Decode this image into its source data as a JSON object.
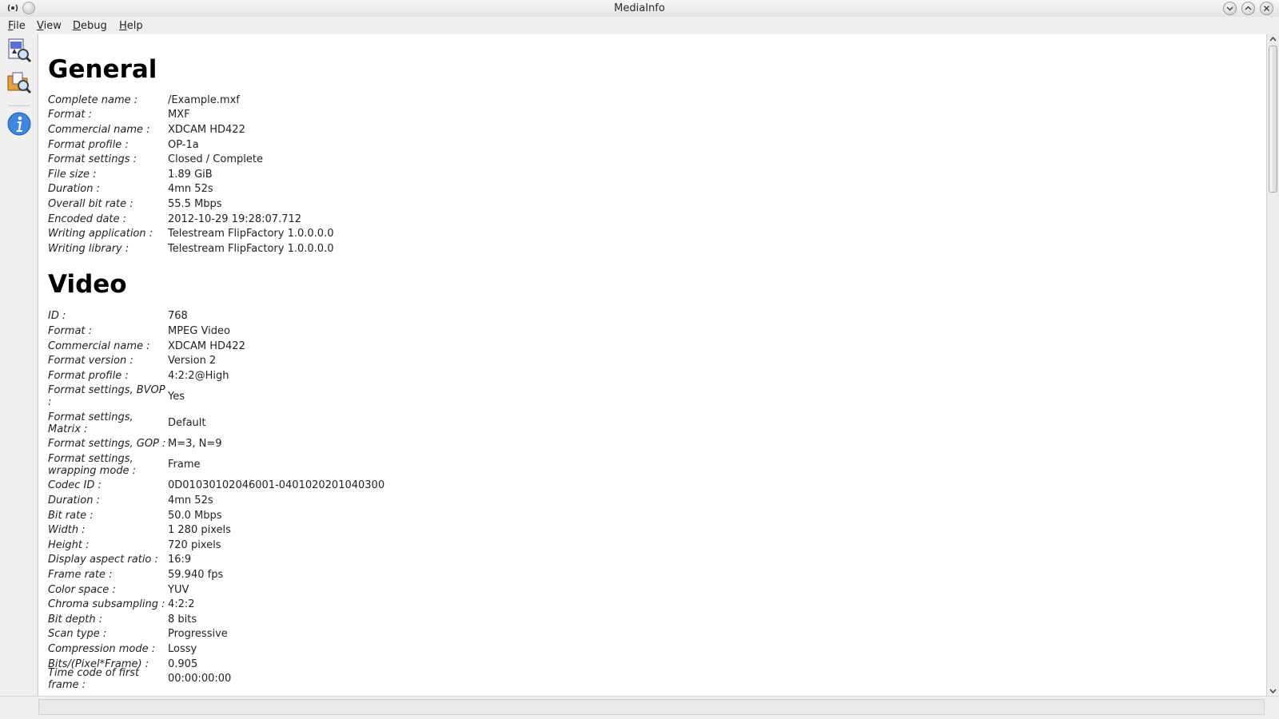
{
  "window": {
    "title": "MediaInfo"
  },
  "menu": [
    {
      "first": "F",
      "rest": "ile"
    },
    {
      "first": "V",
      "rest": "iew"
    },
    {
      "first": "D",
      "rest": "ebug"
    },
    {
      "first": "H",
      "rest": "elp"
    }
  ],
  "toolbar": {
    "open_file_icon": "open-file-icon",
    "open_folder_icon": "open-folder-icon",
    "about_icon": "info-icon"
  },
  "sections": [
    {
      "title": "General",
      "rows": [
        {
          "k": "Complete name :",
          "v": "/Example.mxf"
        },
        {
          "k": "Format :",
          "v": "MXF"
        },
        {
          "k": "Commercial name :",
          "v": "XDCAM HD422"
        },
        {
          "k": "Format profile :",
          "v": "OP-1a"
        },
        {
          "k": "Format settings :",
          "v": "Closed / Complete"
        },
        {
          "k": "File size :",
          "v": "1.89 GiB"
        },
        {
          "k": "Duration :",
          "v": "4mn 52s"
        },
        {
          "k": "Overall bit rate :",
          "v": "55.5 Mbps"
        },
        {
          "k": "Encoded date :",
          "v": "2012-10-29 19:28:07.712"
        },
        {
          "k": "Writing application :",
          "v": "Telestream FlipFactory 1.0.0.0.0"
        },
        {
          "k": "Writing library :",
          "v": "Telestream FlipFactory 1.0.0.0.0"
        }
      ]
    },
    {
      "title": "Video",
      "rows": [
        {
          "k": "ID :",
          "v": "768"
        },
        {
          "k": "Format :",
          "v": "MPEG Video"
        },
        {
          "k": "Commercial name :",
          "v": "XDCAM HD422"
        },
        {
          "k": "Format version :",
          "v": "Version 2"
        },
        {
          "k": "Format profile :",
          "v": "4:2:2@High"
        },
        {
          "k": "Format settings, BVOP :",
          "v": "Yes",
          "wrap": true
        },
        {
          "k": "Format settings, Matrix :",
          "v": "Default",
          "wrap": true
        },
        {
          "k": "Format settings, GOP :",
          "v": "M=3, N=9"
        },
        {
          "k": "Format settings, wrapping mode :",
          "v": "Frame",
          "wrap": true
        },
        {
          "k": "Codec ID :",
          "v": "0D01030102046001-0401020201040300"
        },
        {
          "k": "Duration :",
          "v": "4mn 52s"
        },
        {
          "k": "Bit rate :",
          "v": "50.0 Mbps"
        },
        {
          "k": "Width :",
          "v": "1 280 pixels"
        },
        {
          "k": "Height :",
          "v": "720 pixels"
        },
        {
          "k": "Display aspect ratio :",
          "v": "16:9"
        },
        {
          "k": "Frame rate :",
          "v": "59.940 fps"
        },
        {
          "k": "Color space :",
          "v": "YUV"
        },
        {
          "k": "Chroma subsampling :",
          "v": "4:2:2"
        },
        {
          "k": "Bit depth :",
          "v": "8 bits"
        },
        {
          "k": "Scan type :",
          "v": "Progressive"
        },
        {
          "k": "Compression mode :",
          "v": "Lossy"
        },
        {
          "k": "Bits/(Pixel*Frame) :",
          "v": "0.905"
        },
        {
          "k": "Time code of first frame :",
          "v": "00:00:00:00"
        }
      ]
    }
  ],
  "scroll": {
    "position": 0.0
  }
}
